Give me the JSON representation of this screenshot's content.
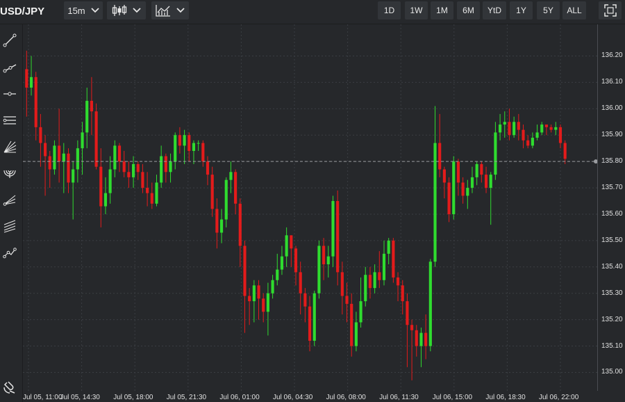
{
  "header": {
    "symbol": "USD/JPY",
    "interval": "15m",
    "chart_style_icon": "candlestick-icon",
    "indicators_icon": "indicators-icon",
    "ranges": [
      "1D",
      "1W",
      "1M",
      "6M",
      "YtD",
      "1Y",
      "5Y",
      "ALL"
    ],
    "fullscreen_icon": "fullscreen-icon"
  },
  "tools": [
    "trend-line-icon",
    "ray-icon",
    "horizontal-line-icon",
    "parallel-channel-icon",
    "fan-icon",
    "arc-icon",
    "pitchfork-icon",
    "fibonacci-icon",
    "path-icon"
  ],
  "bottom_tool": "magnet-icon",
  "colors": {
    "up": "#2fdc2f",
    "down": "#e31b1b",
    "background": "#26282b",
    "grid": "#3b3e43"
  },
  "chart_data": {
    "type": "candlestick",
    "title": "",
    "ylabel": "",
    "xlabel": "",
    "ylim": [
      134.93,
      136.32
    ],
    "y_ticks": [
      "136.20",
      "136.10",
      "136.00",
      "135.90",
      "135.80",
      "135.70",
      "135.60",
      "135.50",
      "135.40",
      "135.30",
      "135.20",
      "135.10",
      "135.00"
    ],
    "x_ticks": [
      "Jul 05, 11:00",
      "Jul 05, 14:30",
      "Jul 05, 18:00",
      "Jul 05, 21:30",
      "Jul 06, 01:00",
      "Jul 06, 04:30",
      "Jul 06, 08:00",
      "Jul 06, 11:30",
      "Jul 06, 15:00",
      "Jul 06, 18:30",
      "Jul 06, 22:00"
    ],
    "last_price": 135.8,
    "last_price_label": "135.80",
    "grid": true,
    "candles": [
      [
        136.15,
        136.08,
        136.22,
        135.97
      ],
      [
        136.08,
        136.12,
        136.2,
        136.05
      ],
      [
        136.12,
        135.93,
        136.14,
        135.88
      ],
      [
        135.93,
        135.87,
        135.98,
        135.78
      ],
      [
        135.87,
        135.82,
        135.9,
        135.67
      ],
      [
        135.82,
        135.77,
        135.84,
        135.7
      ],
      [
        135.77,
        135.86,
        135.88,
        135.75
      ],
      [
        135.86,
        135.8,
        136.0,
        135.72
      ],
      [
        135.8,
        135.83,
        135.87,
        135.68
      ],
      [
        135.83,
        135.72,
        135.85,
        135.68
      ],
      [
        135.72,
        135.77,
        135.8,
        135.58
      ],
      [
        135.77,
        135.85,
        135.88,
        135.72
      ],
      [
        135.85,
        135.91,
        135.95,
        135.75
      ],
      [
        135.91,
        136.03,
        136.08,
        135.85
      ],
      [
        136.03,
        135.99,
        136.12,
        135.9
      ],
      [
        135.99,
        135.78,
        136.02,
        135.77
      ],
      [
        135.78,
        135.63,
        135.85,
        135.55
      ],
      [
        135.63,
        135.68,
        135.74,
        135.6
      ],
      [
        135.68,
        135.77,
        135.82,
        135.64
      ],
      [
        135.77,
        135.86,
        135.88,
        135.74
      ],
      [
        135.86,
        135.8,
        135.87,
        135.76
      ],
      [
        135.8,
        135.76,
        135.84,
        135.74
      ],
      [
        135.76,
        135.74,
        135.8,
        135.7
      ],
      [
        135.74,
        135.79,
        135.82,
        135.7
      ],
      [
        135.79,
        135.76,
        135.8,
        135.73
      ],
      [
        135.76,
        135.7,
        135.79,
        135.68
      ],
      [
        135.7,
        135.68,
        135.76,
        135.63
      ],
      [
        135.68,
        135.64,
        135.72,
        135.62
      ],
      [
        135.64,
        135.72,
        135.75,
        135.63
      ],
      [
        135.72,
        135.82,
        135.86,
        135.7
      ],
      [
        135.82,
        135.76,
        135.83,
        135.72
      ],
      [
        135.76,
        135.8,
        135.83,
        135.72
      ],
      [
        135.8,
        135.9,
        135.91,
        135.77
      ],
      [
        135.9,
        135.86,
        135.93,
        135.83
      ],
      [
        135.86,
        135.9,
        135.92,
        135.79
      ],
      [
        135.9,
        135.84,
        135.91,
        135.8
      ],
      [
        135.84,
        135.87,
        135.88,
        135.79
      ],
      [
        135.87,
        135.87,
        135.88,
        135.84
      ],
      [
        135.87,
        135.8,
        135.88,
        135.78
      ],
      [
        135.8,
        135.75,
        135.82,
        135.71
      ],
      [
        135.75,
        135.62,
        135.78,
        135.59
      ],
      [
        135.62,
        135.53,
        135.66,
        135.47
      ],
      [
        135.53,
        135.58,
        135.62,
        135.49
      ],
      [
        135.58,
        135.73,
        135.74,
        135.55
      ],
      [
        135.73,
        135.76,
        135.8,
        135.68
      ],
      [
        135.76,
        135.64,
        135.77,
        135.6
      ],
      [
        135.64,
        135.48,
        135.66,
        135.4
      ],
      [
        135.48,
        135.29,
        135.5,
        135.15
      ],
      [
        135.29,
        135.27,
        135.32,
        135.18
      ],
      [
        135.27,
        135.33,
        135.35,
        135.19
      ],
      [
        135.33,
        135.28,
        135.35,
        135.2
      ],
      [
        135.28,
        135.23,
        135.3,
        135.19
      ],
      [
        135.23,
        135.3,
        135.34,
        135.14
      ],
      [
        135.3,
        135.35,
        135.37,
        135.28
      ],
      [
        135.35,
        135.39,
        135.45,
        135.33
      ],
      [
        135.39,
        135.44,
        135.48,
        135.37
      ],
      [
        135.44,
        135.52,
        135.55,
        135.4
      ],
      [
        135.52,
        135.47,
        135.52,
        135.4
      ],
      [
        135.47,
        135.38,
        135.48,
        135.33
      ],
      [
        135.38,
        135.3,
        135.42,
        135.22
      ],
      [
        135.3,
        135.25,
        135.32,
        135.19
      ],
      [
        135.25,
        135.12,
        135.29,
        135.08
      ],
      [
        135.12,
        135.3,
        135.31,
        135.1
      ],
      [
        135.3,
        135.48,
        135.5,
        135.28
      ],
      [
        135.48,
        135.41,
        135.51,
        135.35
      ],
      [
        135.41,
        135.44,
        135.48,
        135.36
      ],
      [
        135.44,
        135.65,
        135.67,
        135.4
      ],
      [
        135.65,
        135.38,
        135.69,
        135.33
      ],
      [
        135.38,
        135.29,
        135.42,
        135.22
      ],
      [
        135.29,
        135.26,
        135.34,
        135.19
      ],
      [
        135.26,
        135.1,
        135.3,
        135.06
      ],
      [
        135.1,
        135.19,
        135.23,
        135.08
      ],
      [
        135.19,
        135.27,
        135.36,
        135.17
      ],
      [
        135.27,
        135.37,
        135.4,
        135.25
      ],
      [
        135.37,
        135.32,
        135.4,
        135.28
      ],
      [
        135.32,
        135.38,
        135.41,
        135.3
      ],
      [
        135.38,
        135.35,
        135.46,
        135.32
      ],
      [
        135.35,
        135.45,
        135.5,
        135.33
      ],
      [
        135.45,
        135.5,
        135.51,
        135.41
      ],
      [
        135.5,
        135.36,
        135.51,
        135.34
      ],
      [
        135.36,
        135.33,
        135.38,
        135.27
      ],
      [
        135.33,
        135.27,
        135.35,
        135.22
      ],
      [
        135.27,
        135.18,
        135.3,
        135.02
      ],
      [
        135.18,
        135.16,
        135.2,
        134.97
      ],
      [
        135.16,
        135.1,
        135.18,
        135.06
      ],
      [
        135.1,
        135.15,
        135.17,
        135.02
      ],
      [
        135.15,
        135.1,
        135.22,
        135.05
      ],
      [
        135.1,
        135.42,
        135.43,
        135.08
      ],
      [
        135.42,
        135.87,
        136.01,
        135.4
      ],
      [
        135.87,
        135.77,
        135.98,
        135.74
      ],
      [
        135.77,
        135.72,
        135.78,
        135.66
      ],
      [
        135.72,
        135.6,
        135.74,
        135.57
      ],
      [
        135.6,
        135.8,
        135.82,
        135.58
      ],
      [
        135.8,
        135.72,
        135.81,
        135.67
      ],
      [
        135.72,
        135.67,
        135.74,
        135.64
      ],
      [
        135.67,
        135.7,
        135.73,
        135.62
      ],
      [
        135.7,
        135.74,
        135.78,
        135.68
      ],
      [
        135.74,
        135.79,
        135.8,
        135.71
      ],
      [
        135.79,
        135.75,
        135.8,
        135.72
      ],
      [
        135.75,
        135.7,
        135.78,
        135.68
      ],
      [
        135.7,
        135.75,
        135.76,
        135.56
      ],
      [
        135.75,
        135.91,
        135.95,
        135.73
      ],
      [
        135.91,
        135.94,
        135.98,
        135.88
      ],
      [
        135.94,
        135.95,
        135.99,
        135.89
      ],
      [
        135.95,
        135.9,
        136.0,
        135.88
      ],
      [
        135.9,
        135.95,
        135.97,
        135.89
      ],
      [
        135.95,
        135.92,
        135.98,
        135.88
      ],
      [
        135.92,
        135.88,
        135.94,
        135.85
      ],
      [
        135.88,
        135.86,
        135.9,
        135.85
      ],
      [
        135.86,
        135.89,
        135.91,
        135.85
      ],
      [
        135.89,
        135.91,
        135.94,
        135.88
      ],
      [
        135.91,
        135.94,
        135.95,
        135.9
      ],
      [
        135.94,
        135.93,
        135.94,
        135.9
      ],
      [
        135.93,
        135.92,
        135.94,
        135.91
      ],
      [
        135.92,
        135.93,
        135.95,
        135.9
      ],
      [
        135.93,
        135.87,
        135.94,
        135.85
      ],
      [
        135.87,
        135.81,
        135.88,
        135.79
      ]
    ]
  }
}
